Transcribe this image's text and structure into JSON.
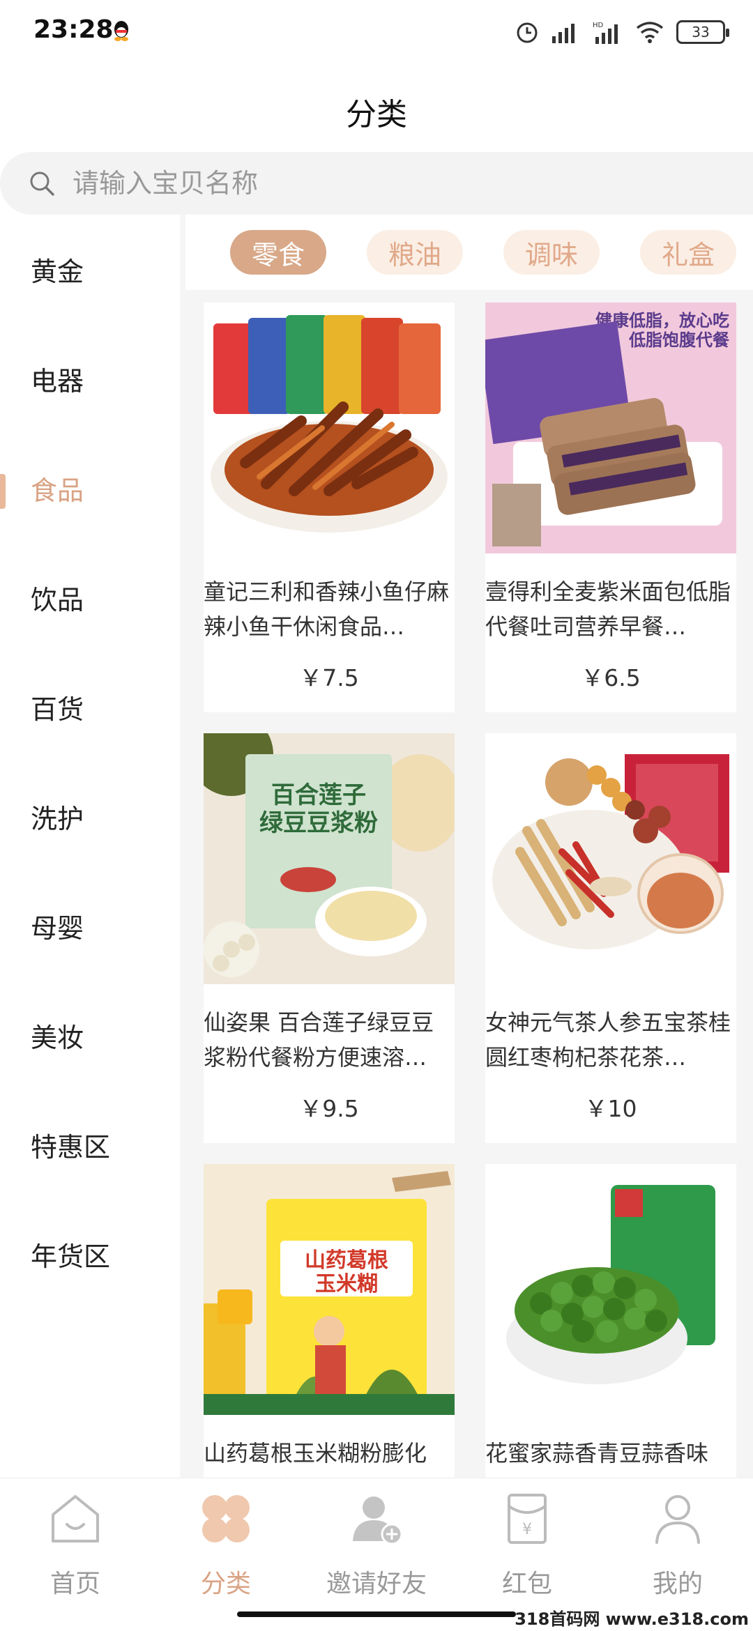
{
  "status": {
    "time": "23:28",
    "battery": "33"
  },
  "header": {
    "title": "分类"
  },
  "search": {
    "placeholder": "请输入宝贝名称"
  },
  "sidebar": {
    "items": [
      {
        "label": "黄金"
      },
      {
        "label": "电器"
      },
      {
        "label": "食品",
        "active": true
      },
      {
        "label": "饮品"
      },
      {
        "label": "百货"
      },
      {
        "label": "洗护"
      },
      {
        "label": "母婴"
      },
      {
        "label": "美妆"
      },
      {
        "label": "特惠区"
      },
      {
        "label": "年货区"
      }
    ]
  },
  "chips": [
    {
      "label": "零食",
      "active": true
    },
    {
      "label": "粮油"
    },
    {
      "label": "调味"
    },
    {
      "label": "礼盒"
    }
  ],
  "products": [
    {
      "title": "童记三利和香辣小鱼仔麻辣小鱼干休闲食品…",
      "price": "￥7.5"
    },
    {
      "title": "壹得利全麦紫米面包低脂代餐吐司营养早餐…",
      "price": "￥6.5",
      "banner_1": "健康低脂，放心吃",
      "banner_2": "低脂饱腹代餐"
    },
    {
      "title": "仙姿果 百合莲子绿豆豆浆粉代餐粉方便速溶…",
      "price": "￥9.5",
      "pack_1": "百合莲子",
      "pack_2": "绿豆豆浆粉"
    },
    {
      "title": "女神元气茶人参五宝茶桂圆红枣枸杞茶花茶…",
      "price": "￥10"
    },
    {
      "title": "山药葛根玉米糊粉膨化",
      "price": "",
      "pack_1": "山药葛根",
      "pack_2": "玉米糊"
    },
    {
      "title": "花蜜家蒜香青豆蒜香味",
      "price": ""
    }
  ],
  "nav": {
    "items": [
      {
        "label": "首页",
        "icon": "home-icon"
      },
      {
        "label": "分类",
        "icon": "category-icon",
        "active": true
      },
      {
        "label": "邀请好友",
        "icon": "invite-friend-icon"
      },
      {
        "label": "红包",
        "icon": "red-packet-icon"
      },
      {
        "label": "我的",
        "icon": "profile-icon"
      }
    ]
  },
  "watermark": "318首码网 www.e318.com",
  "colors": {
    "accent": "#d9a384",
    "chip_bg": "#fbeee4",
    "chip_active": "#d8a888"
  }
}
